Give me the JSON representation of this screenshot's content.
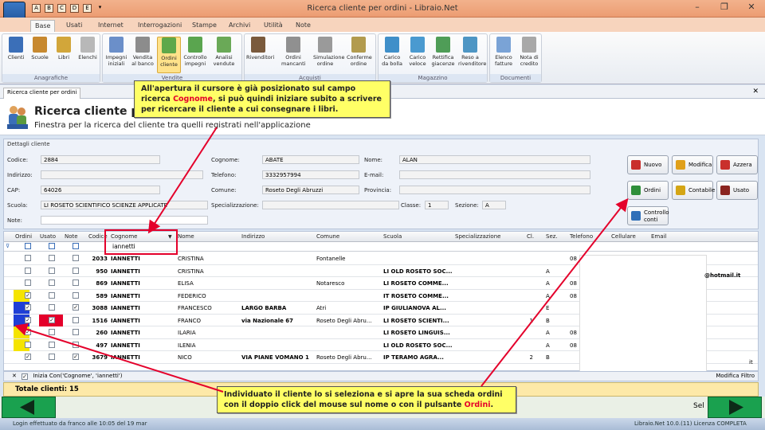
{
  "window": {
    "title": "Ricerca cliente per ordini - Libraio.Net"
  },
  "quick_access": [
    "A",
    "B",
    "C",
    "D",
    "E",
    "F"
  ],
  "tabs": [
    "Base",
    "Usati",
    "Internet",
    "Interrogazioni",
    "Stampe",
    "Archivi",
    "Utilità",
    "Note"
  ],
  "ribbon": {
    "groups": [
      {
        "label": "Anagrafiche",
        "buttons": [
          "Clienti",
          "Scuole",
          "Libri",
          "Elenchi"
        ]
      },
      {
        "label": "Vendite",
        "buttons": [
          "Impegni iniziali",
          "Vendita al banco",
          "Ordini cliente",
          "Controllo impegni",
          "Analisi vendute"
        ]
      },
      {
        "label": "Acquisti",
        "buttons": [
          "Rivenditori",
          "Ordini mancanti",
          "Simulazione ordine",
          "Conferme ordine"
        ]
      },
      {
        "label": "Magazzino",
        "buttons": [
          "Carico da bolla",
          "Carico veloce",
          "Rettifica giacenze",
          "Reso a rivenditore"
        ]
      },
      {
        "label": "Documenti",
        "buttons": [
          "Elenco fatture",
          "Nota di credito"
        ]
      }
    ]
  },
  "doc_tab": "Ricerca cliente per ordini",
  "header": {
    "title": "Ricerca cliente per o",
    "subtitle": "Finestra per la ricerca del cliente tra quelli registrati nell'applicazione"
  },
  "details": {
    "title": "Dettagli cliente",
    "labels": {
      "codice": "Codice:",
      "indirizzo": "Indirizzo:",
      "cap": "CAP:",
      "scuola": "Scuola:",
      "note": "Note:",
      "cognome": "Cognome:",
      "telefono": "Telefono:",
      "comune": "Comune:",
      "specializzazione": "Specializzazione:",
      "nome": "Nome:",
      "email": "E-mail:",
      "provincia": "Provincia:",
      "classe": "Classe:",
      "sezione": "Sezione:"
    },
    "values": {
      "codice": "2884",
      "indirizzo": "",
      "cap": "64026",
      "scuola": "LI ROSETO SCIENTIFICO SCIENZE APPLICATE",
      "note": "",
      "cognome": "ABATE",
      "telefono": "3332957994",
      "comune": "Roseto Degli Abruzzi",
      "specializzazione": "",
      "nome": "ALAN",
      "email": "",
      "provincia": "",
      "classe": "1",
      "sezione": "A"
    }
  },
  "actions": [
    {
      "label": "Nuovo",
      "color": "#c9302c"
    },
    {
      "label": "Modifica",
      "color": "#e0a01a"
    },
    {
      "label": "Azzera",
      "color": "#c9302c"
    },
    {
      "label": "Ordini",
      "color": "#2f8f3a"
    },
    {
      "label": "Contabile",
      "color": "#d4a514"
    },
    {
      "label": "Usato",
      "color": "#8a2420"
    },
    {
      "label": "Controllo conti",
      "color": "#2f6fb8"
    }
  ],
  "grid": {
    "columns": [
      "Ordini",
      "Usato",
      "Note",
      "Codice",
      "Cognome",
      "Nome",
      "Indirizzo",
      "Comune",
      "Scuola",
      "Specializzazione",
      "Cl.",
      "Sez.",
      "Telefono",
      "Cellulare",
      "Email"
    ],
    "filter_value": "iannetti",
    "rows": [
      {
        "ordini": false,
        "usato": false,
        "note": false,
        "codice": "2033",
        "cognome": "IANNETTI",
        "nome": "CRISTINA",
        "indirizzo": "",
        "comune": "Fontanelle",
        "scuola": "",
        "cl": "",
        "sez": "",
        "tel": "08",
        "hl_ordini": false,
        "hl_usato": false
      },
      {
        "ordini": false,
        "usato": false,
        "note": false,
        "codice": "950",
        "cognome": "IANNETTI",
        "nome": "CRISTINA",
        "indirizzo": "",
        "comune": "",
        "scuola": "LI OLD ROSETO SOC...",
        "cl": "",
        "sez": "A",
        "tel": "",
        "hl_ordini": false,
        "hl_usato": false
      },
      {
        "ordini": false,
        "usato": false,
        "note": false,
        "codice": "869",
        "cognome": "IANNETTI",
        "nome": "ELISA",
        "indirizzo": "",
        "comune": "Notaresco",
        "scuola": "LI ROSETO COMME...",
        "cl": "",
        "sez": "A",
        "tel": "08",
        "hl_ordini": false,
        "hl_usato": false
      },
      {
        "ordini": true,
        "usato": false,
        "note": false,
        "codice": "589",
        "cognome": "IANNETTI",
        "nome": "FEDERICO",
        "indirizzo": "",
        "comune": "",
        "scuola": "IT ROSETO COMME...",
        "cl": "",
        "sez": "A",
        "tel": "08",
        "hl_ordini": true,
        "hl_usato": false
      },
      {
        "ordini": true,
        "usato": false,
        "note": true,
        "codice": "3088",
        "cognome": "IANNETTI",
        "nome": "FRANCESCO",
        "indirizzo": "LARGO BARBA",
        "comune": "Atri",
        "scuola": "IP GIULIANOVA AL...",
        "cl": "",
        "sez": "E",
        "tel": "",
        "hl_ordini": true,
        "hl_usato": false
      },
      {
        "ordini": true,
        "usato": true,
        "note": false,
        "codice": "1516",
        "cognome": "IANNETTI",
        "nome": "FRANCO",
        "indirizzo": "via Nazionale 67",
        "comune": "Roseto Degli Abru...",
        "scuola": "LI ROSETO SCIENTI...",
        "cl": "1",
        "sez": "B",
        "tel": "",
        "hl_ordini": true,
        "hl_usato": true
      },
      {
        "ordini": true,
        "usato": false,
        "note": false,
        "codice": "260",
        "cognome": "IANNETTI",
        "nome": "ILARIA",
        "indirizzo": "",
        "comune": "",
        "scuola": "LI ROSETO LINGUIS...",
        "cl": "",
        "sez": "A",
        "tel": "08",
        "hl_ordini": true,
        "hl_usato": false
      },
      {
        "ordini": false,
        "usato": false,
        "note": false,
        "codice": "497",
        "cognome": "IANNETTI",
        "nome": "ILENIA",
        "indirizzo": "",
        "comune": "",
        "scuola": "LI OLD ROSETO SOC...",
        "cl": "",
        "sez": "A",
        "tel": "08",
        "hl_ordini": true,
        "hl_usato": false
      },
      {
        "ordini": true,
        "usato": false,
        "note": true,
        "codice": "3679",
        "cognome": "IANNETTI",
        "nome": "NICO",
        "indirizzo": "VIA PIANE VOMANO 1",
        "comune": "Roseto Degli Abru...",
        "scuola": "IP TERAMO AGRA...",
        "cl": "2",
        "sez": "B",
        "tel": "",
        "hl_ordini": false,
        "hl_usato": false
      }
    ],
    "email_fragment": "@hotmail.it",
    "email_fragment_2": "it"
  },
  "filter_status": "Inizia Con('Cognome', 'iannetti')",
  "filter_edit": "Modifica Filtro",
  "totals": "Totale clienti: 15",
  "select_label": "Sel",
  "status": {
    "left": "Login effettuato da franco alle 10:05 del 19 mar",
    "right": "Libraio.Net 10.0.(11) Licenza COMPLETA"
  },
  "callouts": {
    "top_pre": "All'apertura il cursore è già posizionato sul campo ricerca ",
    "top_hl": "Cognome",
    "top_post": ", si può quindi iniziare subito a scrivere per ricercare il cliente a cui consegnare i libri.",
    "bottom_pre": "Individuato il cliente lo si seleziona e si apre la sua scheda ordini con il doppio click del mouse sul nome o con il pulsante ",
    "bottom_hl": "Ordini",
    "bottom_post": "."
  },
  "colors": {
    "highlight_red": "#e4002b",
    "callout_bg": "#ffff66",
    "selected_yellow": "#f5e400",
    "selected_blue": "#1f3fd6",
    "selected_red": "#e4002b",
    "nav_green": "#1aa14f"
  }
}
